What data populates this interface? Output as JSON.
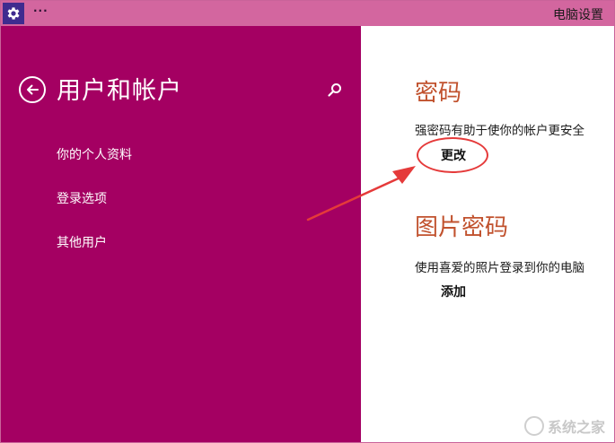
{
  "window": {
    "title": "电脑设置",
    "title_dots": "···",
    "app_icon": "gear-icon"
  },
  "left_panel": {
    "title": "用户和帐户",
    "back_icon": "back-arrow-icon",
    "search_icon": "search-icon",
    "items": [
      {
        "label": "你的个人资料"
      },
      {
        "label": "登录选项"
      },
      {
        "label": "其他用户"
      }
    ]
  },
  "right_panel": {
    "password": {
      "title": "密码",
      "description": "强密码有助于使你的帐户更安全",
      "action": "更改"
    },
    "picture_password": {
      "title": "图片密码",
      "description": "使用喜爱的照片登录到你的电脑",
      "action": "添加"
    }
  },
  "annotation": {
    "color": "#e53a3a"
  },
  "watermark": {
    "text": "系统之家"
  },
  "colors": {
    "titlebar": "#d3669f",
    "left_panel": "#a40062",
    "accent_title": "#c1522e"
  }
}
